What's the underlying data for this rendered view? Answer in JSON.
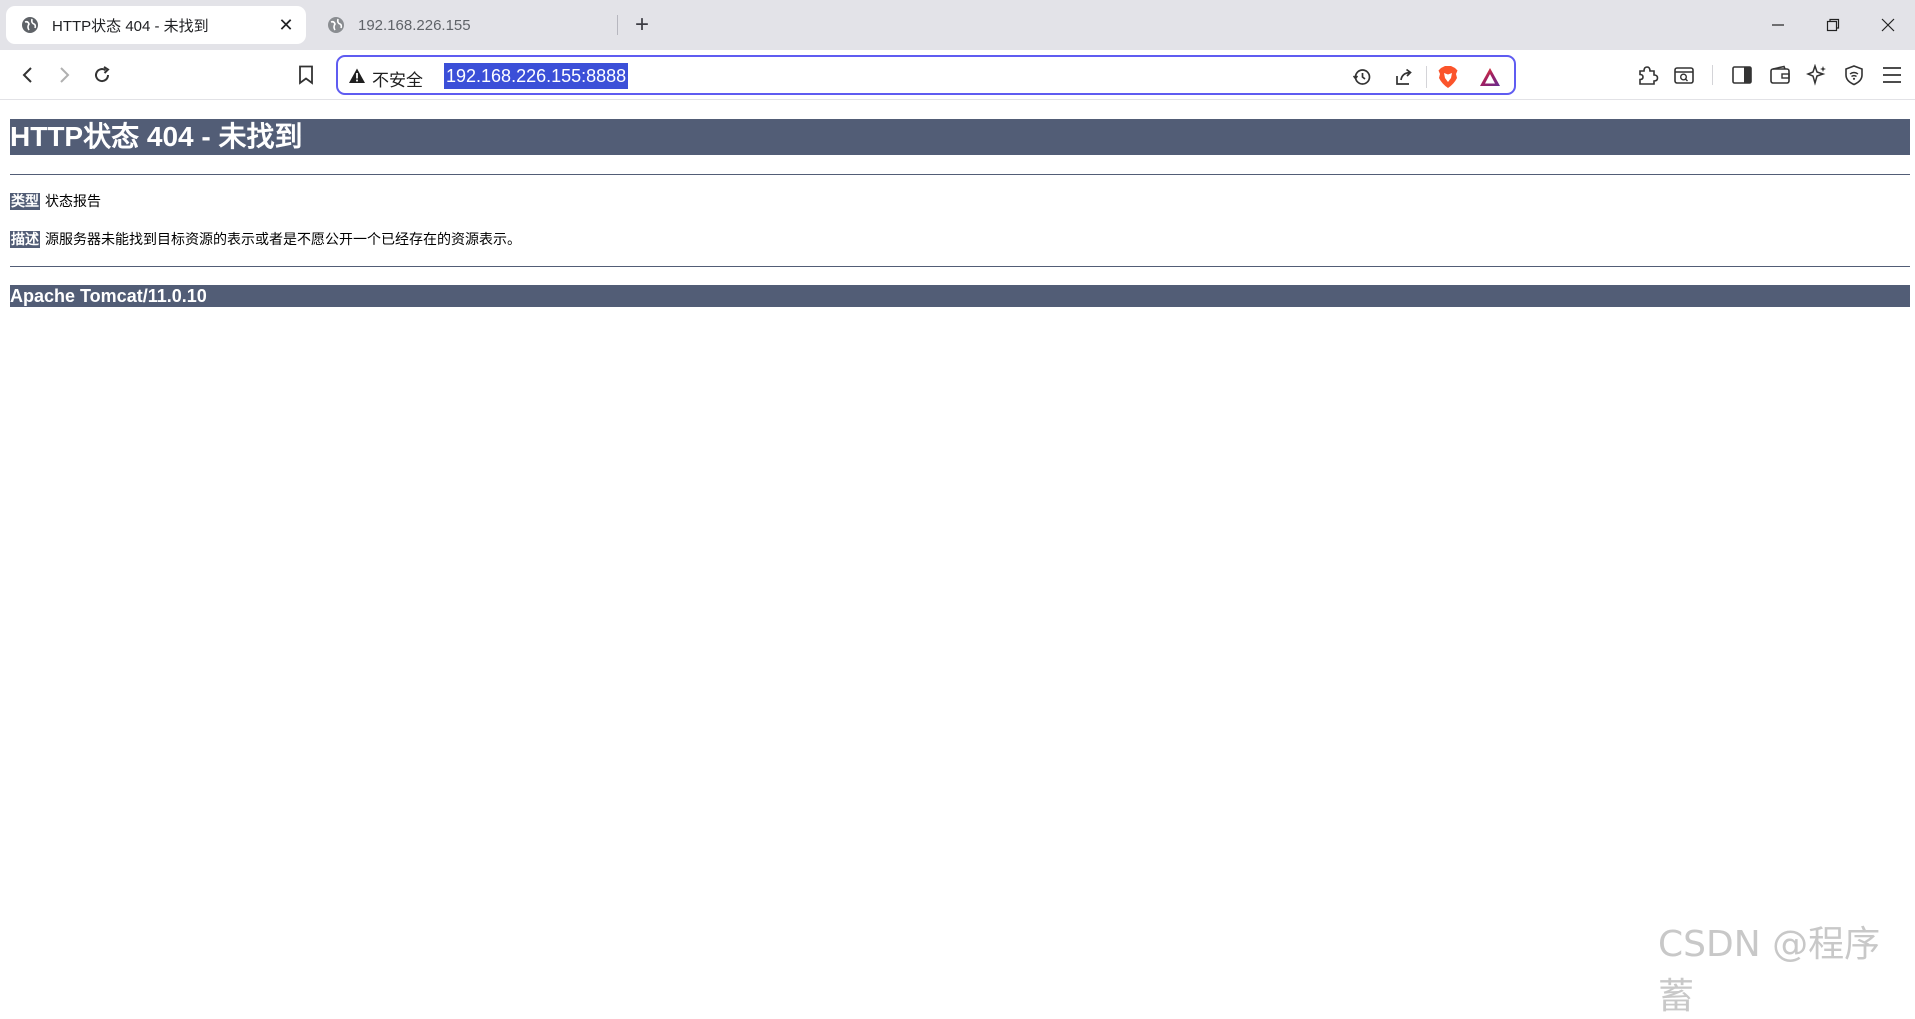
{
  "tabs": [
    {
      "label": "HTTP状态 404 - 未找到",
      "active": true
    },
    {
      "label": "192.168.226.155",
      "active": false
    }
  ],
  "address_bar": {
    "security_label": "不安全",
    "url": "192.168.226.155:8888"
  },
  "page": {
    "heading": "HTTP状态 404 - 未找到",
    "type_label": "类型",
    "type_value": "状态报告",
    "desc_label": "描述",
    "desc_value": "源服务器未能找到目标资源的表示或者是不愿公开一个已经存在的资源表示。",
    "server": "Apache Tomcat/11.0.10"
  },
  "watermark": "CSDN @程序蓄",
  "colors": {
    "tomcat_header": "#525d76",
    "omnibox_focus": "#5f5cf1",
    "url_selection": "#3b4fd8",
    "tabstrip_bg": "#e3e3e8"
  }
}
